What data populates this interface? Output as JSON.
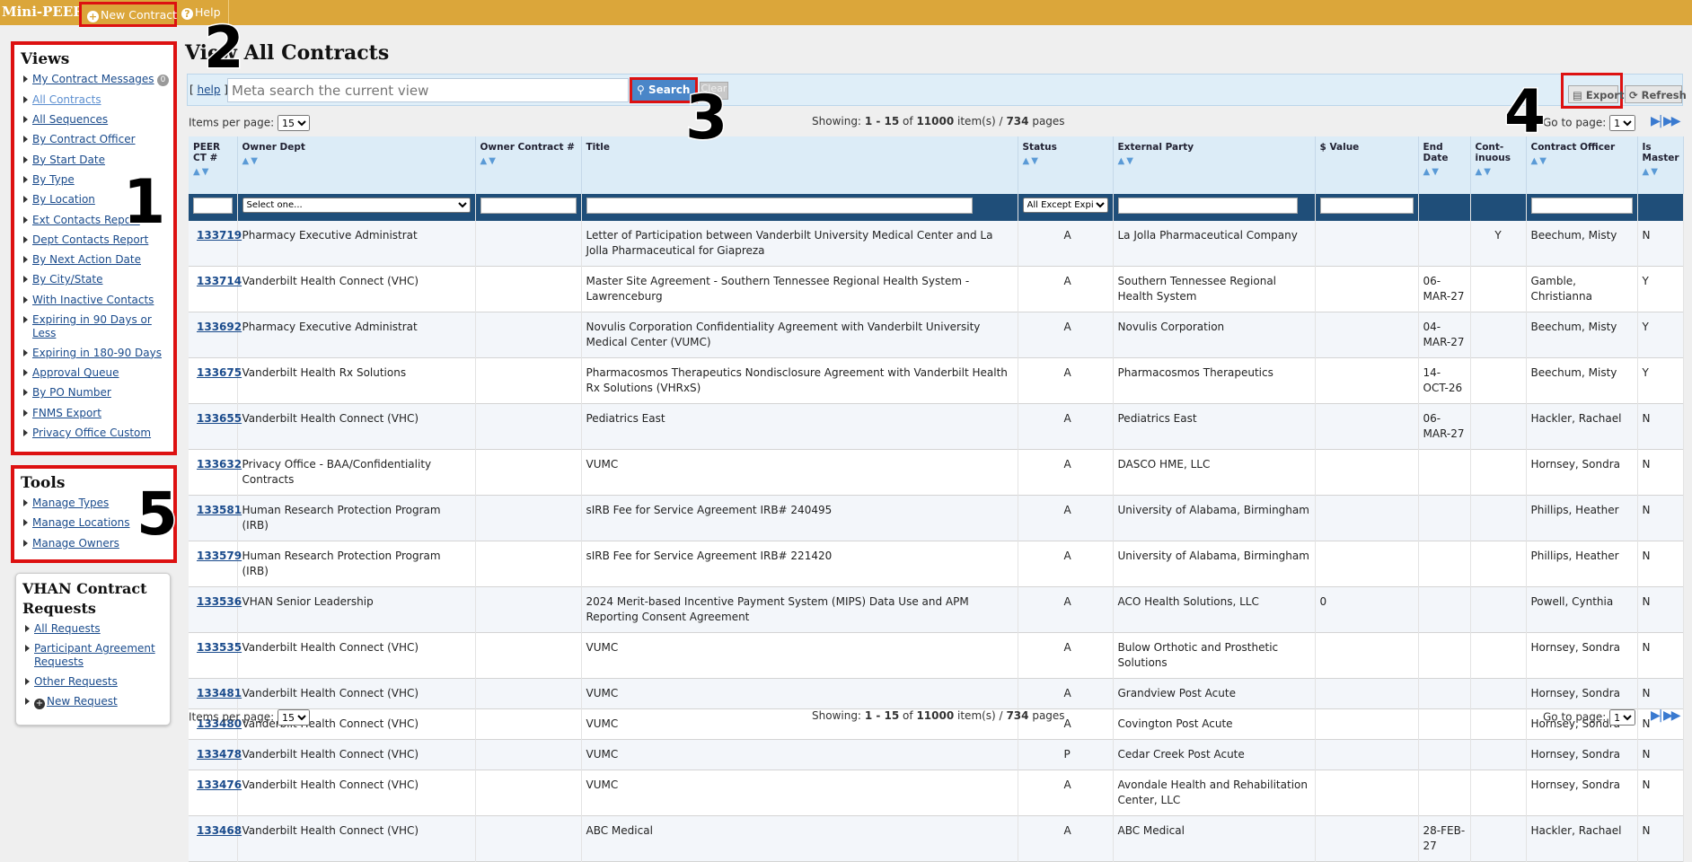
{
  "app": {
    "brand": "Mini-PEER",
    "new_contract": "New Contract",
    "help": "Help"
  },
  "views": {
    "title": "Views",
    "items": [
      {
        "label": "My Contract Messages",
        "badge": "0"
      },
      {
        "label": "All Contracts"
      },
      {
        "label": "All Sequences"
      },
      {
        "label": "By Contract Officer"
      },
      {
        "label": "By Start Date"
      },
      {
        "label": "By Type"
      },
      {
        "label": "By Location"
      },
      {
        "label": "Ext Contacts Report"
      },
      {
        "label": "Dept Contacts Report"
      },
      {
        "label": "By Next Action Date"
      },
      {
        "label": "By City/State"
      },
      {
        "label": "With Inactive Contacts"
      },
      {
        "label": "Expiring in 90 Days or Less"
      },
      {
        "label": "Expiring in 180-90 Days"
      },
      {
        "label": "Approval Queue"
      },
      {
        "label": "By PO Number"
      },
      {
        "label": "FNMS Export"
      },
      {
        "label": "Privacy Office Custom"
      }
    ]
  },
  "tools": {
    "title": "Tools",
    "items": [
      {
        "label": "Manage Types"
      },
      {
        "label": "Manage Locations"
      },
      {
        "label": "Manage Owners"
      }
    ]
  },
  "vhan": {
    "title": "VHAN Contract Requests",
    "items": [
      {
        "label": "All Requests"
      },
      {
        "label": "Participant Agreement Requests"
      },
      {
        "label": "Other Requests"
      },
      {
        "label": "New Request"
      }
    ]
  },
  "annotations": [
    "1",
    "2",
    "3",
    "4",
    "5"
  ],
  "page": {
    "title": "View All Contracts",
    "help_link": "help",
    "search_placeholder": "Meta search the current view",
    "search_button": "Search",
    "clear_button": "Clear",
    "export_button": "Export",
    "refresh_button": "Refresh"
  },
  "pager": {
    "items_per_page_label": "Items per page:",
    "items_per_page": "15",
    "showing_label": "Showing:",
    "range": "1 - 15",
    "of": "of",
    "total_items": "11000",
    "items_label": "item(s) /",
    "total_pages": "734",
    "pages_label": "pages",
    "goto_label": "Go to page:",
    "page": "1"
  },
  "columns": [
    "PEER CT #",
    "Owner Dept",
    "Owner Contract #",
    "Title",
    "Status",
    "External Party",
    "$ Value",
    "End Date",
    "Cont-inuous",
    "Contract Officer",
    "Is Master"
  ],
  "filters": {
    "owner_dept": "Select one...",
    "status": "All Except Expired"
  },
  "rows": [
    {
      "id": "133719",
      "dept": "Pharmacy Executive Administrat",
      "owner_no": "",
      "title": "Letter of Participation between Vanderbilt University Medical Center and La Jolla Pharmaceutical for Giapreza",
      "status": "A",
      "party": "La Jolla Pharmaceutical Company",
      "value": "",
      "end": "",
      "cont": "Y",
      "officer": "Beechum, Misty",
      "master": "N"
    },
    {
      "id": "133714",
      "dept": "Vanderbilt Health Connect (VHC)",
      "owner_no": "",
      "title": "Master Site Agreement - Southern Tennessee Regional Health System - Lawrenceburg",
      "status": "A",
      "party": "Southern Tennessee Regional Health System",
      "value": "",
      "end": "06-MAR-27",
      "cont": "",
      "officer": "Gamble, Christianna",
      "master": "Y"
    },
    {
      "id": "133692",
      "dept": "Pharmacy Executive Administrat",
      "owner_no": "",
      "title": "Novulis Corporation Confidentiality Agreement with Vanderbilt University Medical Center (VUMC)",
      "status": "A",
      "party": "Novulis Corporation",
      "value": "",
      "end": "04-MAR-27",
      "cont": "",
      "officer": "Beechum, Misty",
      "master": "Y"
    },
    {
      "id": "133675",
      "dept": "Vanderbilt Health Rx Solutions",
      "owner_no": "",
      "title": "Pharmacosmos Therapeutics Nondisclosure Agreement with Vanderbilt Health Rx Solutions (VHRxS)",
      "status": "A",
      "party": "Pharmacosmos Therapeutics",
      "value": "",
      "end": "14-OCT-26",
      "cont": "",
      "officer": "Beechum, Misty",
      "master": "Y"
    },
    {
      "id": "133655",
      "dept": "Vanderbilt Health Connect (VHC)",
      "owner_no": "",
      "title": "Pediatrics East",
      "status": "A",
      "party": "Pediatrics East",
      "value": "",
      "end": "06-MAR-27",
      "cont": "",
      "officer": "Hackler, Rachael",
      "master": "N"
    },
    {
      "id": "133632",
      "dept": "Privacy Office - BAA/Confidentiality Contracts",
      "owner_no": "",
      "title": "VUMC",
      "status": "A",
      "party": "DASCO HME, LLC",
      "value": "",
      "end": "",
      "cont": "",
      "officer": "Hornsey, Sondra",
      "master": "N"
    },
    {
      "id": "133581",
      "dept": "Human Research Protection Program (IRB)",
      "owner_no": "",
      "title": "sIRB Fee for Service Agreement IRB# 240495",
      "status": "A",
      "party": "University of Alabama, Birmingham",
      "value": "",
      "end": "",
      "cont": "",
      "officer": "Phillips, Heather",
      "master": "N"
    },
    {
      "id": "133579",
      "dept": "Human Research Protection Program (IRB)",
      "owner_no": "",
      "title": "sIRB Fee for Service Agreement IRB# 221420",
      "status": "A",
      "party": "University of Alabama, Birmingham",
      "value": "",
      "end": "",
      "cont": "",
      "officer": "Phillips, Heather",
      "master": "N"
    },
    {
      "id": "133536",
      "dept": "VHAN Senior Leadership",
      "owner_no": "",
      "title": "2024 Merit-based Incentive Payment System (MIPS) Data Use and APM Reporting Consent Agreement",
      "status": "A",
      "party": "ACO Health Solutions, LLC",
      "value": "0",
      "end": "",
      "cont": "",
      "officer": "Powell, Cynthia",
      "master": "N"
    },
    {
      "id": "133535",
      "dept": "Vanderbilt Health Connect (VHC)",
      "owner_no": "",
      "title": "VUMC",
      "status": "A",
      "party": "Bulow Orthotic and Prosthetic Solutions",
      "value": "",
      "end": "",
      "cont": "",
      "officer": "Hornsey, Sondra",
      "master": "N"
    },
    {
      "id": "133481",
      "dept": "Vanderbilt Health Connect (VHC)",
      "owner_no": "",
      "title": "VUMC",
      "status": "A",
      "party": "Grandview Post Acute",
      "value": "",
      "end": "",
      "cont": "",
      "officer": "Hornsey, Sondra",
      "master": "N"
    },
    {
      "id": "133480",
      "dept": "Vanderbilt Health Connect (VHC)",
      "owner_no": "",
      "title": "VUMC",
      "status": "A",
      "party": "Covington Post Acute",
      "value": "",
      "end": "",
      "cont": "",
      "officer": "Hornsey, Sondra",
      "master": "N"
    },
    {
      "id": "133478",
      "dept": "Vanderbilt Health Connect (VHC)",
      "owner_no": "",
      "title": "VUMC",
      "status": "P",
      "party": "Cedar Creek Post Acute",
      "value": "",
      "end": "",
      "cont": "",
      "officer": "Hornsey, Sondra",
      "master": "N"
    },
    {
      "id": "133476",
      "dept": "Vanderbilt Health Connect (VHC)",
      "owner_no": "",
      "title": "VUMC",
      "status": "A",
      "party": "Avondale Health and Rehabilitation Center, LLC",
      "value": "",
      "end": "",
      "cont": "",
      "officer": "Hornsey, Sondra",
      "master": "N"
    },
    {
      "id": "133468",
      "dept": "Vanderbilt Health Connect (VHC)",
      "owner_no": "",
      "title": "ABC Medical",
      "status": "A",
      "party": "ABC Medical",
      "value": "",
      "end": "28-FEB-27",
      "cont": "",
      "officer": "Hackler, Rachael",
      "master": "N"
    }
  ]
}
